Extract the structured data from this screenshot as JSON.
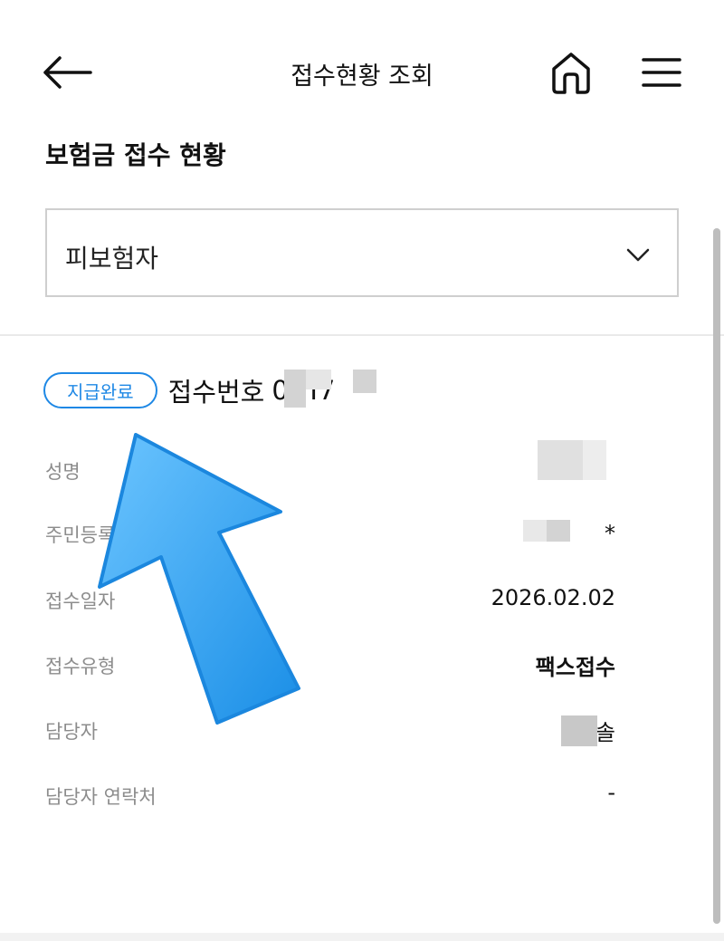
{
  "header": {
    "title": "접수현황 조회"
  },
  "section": {
    "title": "보험금 접수 현황"
  },
  "selector": {
    "value": "피보험자"
  },
  "record": {
    "status_badge": "지급완료",
    "receipt_label": "접수번호",
    "receipt_number": "0(           I7",
    "rows": [
      {
        "label": "성명",
        "value": ""
      },
      {
        "label": "주민등록",
        "value": "*"
      },
      {
        "label": "접수일자",
        "value": "2026.02.02"
      },
      {
        "label": "접수유형",
        "value": "팩스접수"
      },
      {
        "label": "담당자",
        "value": "정  솔"
      },
      {
        "label": "담당자 연락처",
        "value": "-"
      }
    ]
  },
  "colors": {
    "badge": "#1e88e5",
    "annotation_arrow": "#2f9ff0"
  },
  "icons": {
    "back": "arrow-left-icon",
    "home": "home-icon",
    "menu": "hamburger-menu-icon",
    "chevron": "chevron-down-icon"
  }
}
